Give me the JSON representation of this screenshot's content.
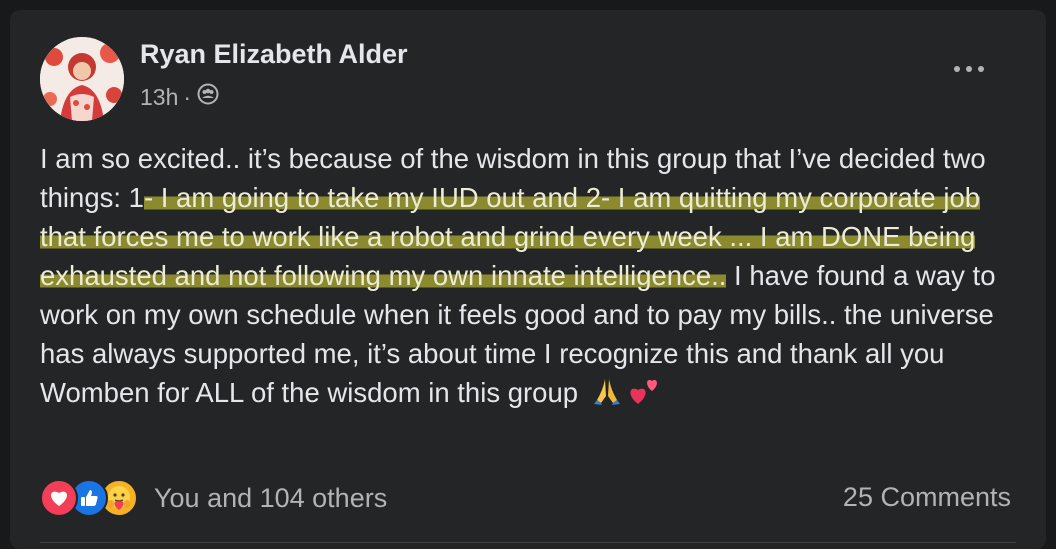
{
  "post": {
    "author": "Ryan Elizabeth Alder",
    "time": "13h",
    "separator": "·",
    "audience_icon": "group-icon",
    "more_icon": "more-options-icon",
    "text": {
      "pre": "I am so excited.. it’s because of the wisdom in this group that I’ve decided two things: 1",
      "highlighted": "- I am going to take my IUD out and 2- I am quitting my corporate job that forces me to work like a robot and grind every week ... I am DONE being exhausted and not following my own innate intelligence..",
      "post": " I have found a way to work on my own schedule when it feels good and to pay my bills.. the universe has always supported me, it’s about time I recognize this and thank all you Womben for ALL of the wisdom in this group",
      "emojis": [
        "folded-hands-emoji",
        "two-hearts-emoji"
      ]
    },
    "highlight_color": "#8b8a2e"
  },
  "footer": {
    "reactions": [
      "love-reaction-icon",
      "like-reaction-icon",
      "care-reaction-icon"
    ],
    "reaction_text": "You and 104 others",
    "comments": "25 Comments"
  },
  "colors": {
    "card": "#242526",
    "text_primary": "#e4e6eb",
    "text_secondary": "#b0b3b8",
    "love": "#f33e58",
    "like": "#1b74e4",
    "care": "#f7b125"
  }
}
